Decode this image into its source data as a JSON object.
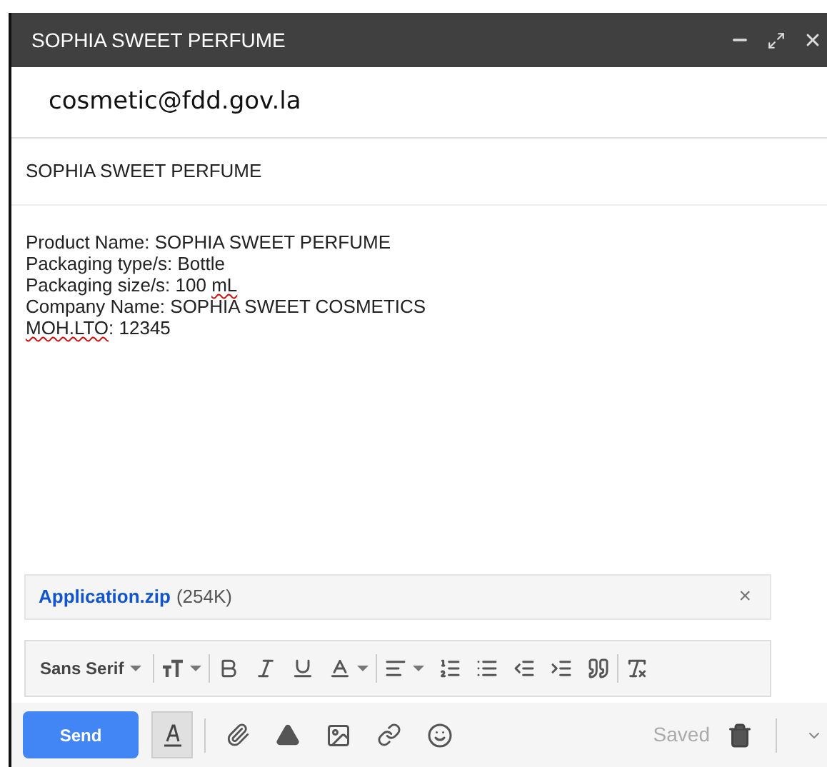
{
  "window": {
    "title": "SOPHIA SWEET PERFUME"
  },
  "to": {
    "value": "cosmetic@fdd.gov.la"
  },
  "subject": {
    "value": "SOPHIA SWEET PERFUME"
  },
  "body": [
    [
      {
        "text": "Product Name: SOPHIA SWEET PERFUME",
        "misspelled": false
      }
    ],
    [
      {
        "text": "Packaging type/s: Bottle",
        "misspelled": false
      }
    ],
    [
      {
        "text": "Packaging size/s: 100 ",
        "misspelled": false
      },
      {
        "text": "mL",
        "misspelled": true
      }
    ],
    [
      {
        "text": "Company Name: SOPHIA SWEET COSMETICS",
        "misspelled": false
      }
    ],
    [
      {
        "text": "MOH.LTO",
        "misspelled": true
      },
      {
        "text": ": 12345",
        "misspelled": false
      }
    ]
  ],
  "attachment": {
    "name": "Application.zip",
    "size": "(254K)",
    "remove": "×"
  },
  "format_toolbar": {
    "font": "Sans Serif"
  },
  "bottom_bar": {
    "send": "Send",
    "status": "Saved",
    "formatting_selected": true
  }
}
